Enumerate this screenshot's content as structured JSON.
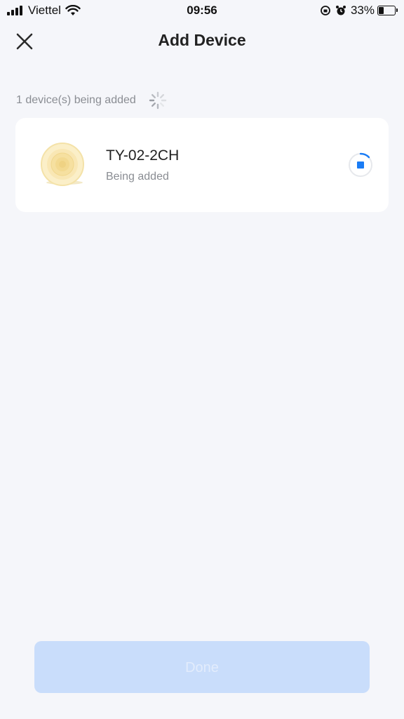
{
  "status_bar": {
    "carrier": "Viettel",
    "time": "09:56",
    "battery_percent": "33%",
    "battery_level": 0.33,
    "icons": [
      "signal-icon",
      "wifi-icon",
      "orientation-lock-icon",
      "alarm-icon",
      "battery-icon"
    ]
  },
  "header": {
    "title": "Add Device",
    "close_icon": "close-icon"
  },
  "progress": {
    "count_text": "1 device(s) being added",
    "spinner_icon": "loading-spinner-icon"
  },
  "devices": [
    {
      "name": "TY-02-2CH",
      "status": "Being added",
      "image_icon": "device-image",
      "action_icon": "stop-icon"
    }
  ],
  "footer": {
    "done_label": "Done"
  },
  "colors": {
    "accent": "#1a7cf5",
    "background": "#f5f6fa",
    "done_disabled_bg": "#c9ddfb"
  }
}
